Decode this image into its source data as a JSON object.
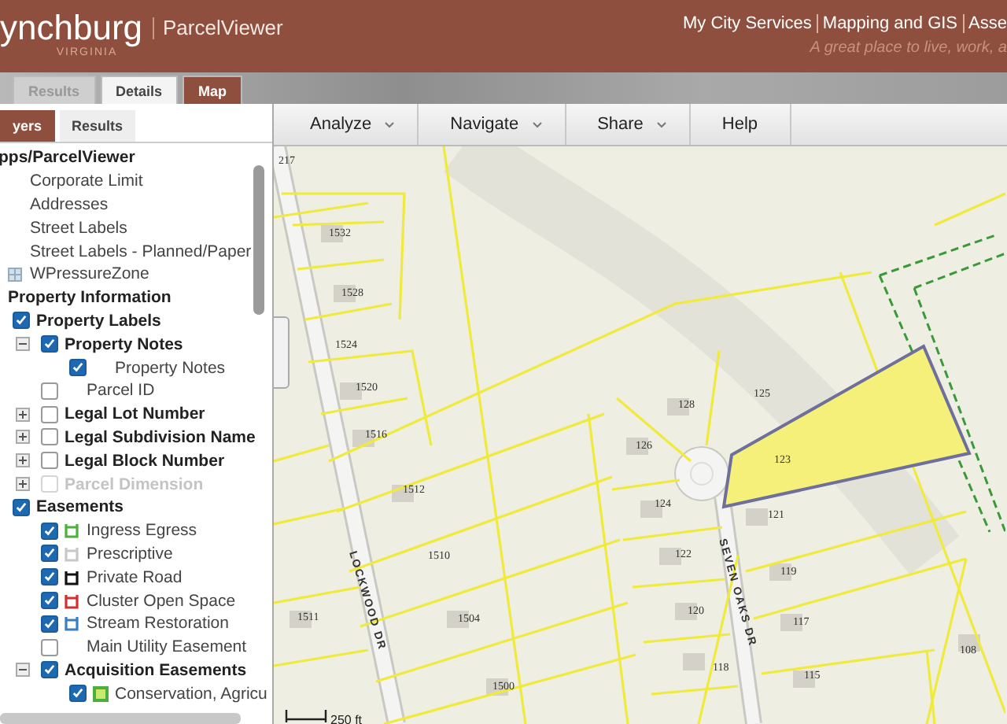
{
  "header": {
    "logo": "ynchburg",
    "logo_sub": "VIRGINIA",
    "app_name": "ParcelViewer",
    "links": [
      "My City Services",
      "Mapping and GIS",
      "Asse"
    ],
    "tagline": "A great place to live, work, a"
  },
  "main_tabs": [
    {
      "label": "Results",
      "selected": false,
      "disabled": true
    },
    {
      "label": "Details",
      "selected": false,
      "disabled": false
    },
    {
      "label": "Map",
      "selected": true,
      "disabled": false
    }
  ],
  "panel_tabs": [
    {
      "label": "yers",
      "selected": true
    },
    {
      "label": "Results",
      "selected": false
    }
  ],
  "layers": {
    "title": "pps/ParcelViewer",
    "items": [
      {
        "kind": "layer",
        "label": "Corporate Limit"
      },
      {
        "kind": "layer",
        "label": "Addresses"
      },
      {
        "kind": "layer",
        "label": "Street Labels"
      },
      {
        "kind": "layer",
        "label": "Street Labels - Planned/Paper"
      },
      {
        "kind": "layer",
        "label": "WPressureZone",
        "swatch": {
          "kind": "grid"
        }
      },
      {
        "kind": "group",
        "label": "Property Information",
        "children": [
          {
            "kind": "group",
            "label": "Property Labels",
            "checked": true,
            "children": [
              {
                "kind": "group",
                "label": "Property Notes",
                "checked": true,
                "expanded": true,
                "children": [
                  {
                    "kind": "layer",
                    "label": "Property Notes",
                    "checked": true
                  }
                ]
              },
              {
                "kind": "layer",
                "label": "Parcel ID",
                "checked": false
              },
              {
                "kind": "group",
                "label": "Legal Lot Number",
                "checked": false,
                "expanded": false
              },
              {
                "kind": "group",
                "label": "Legal Subdivision Name",
                "checked": false,
                "expanded": false
              },
              {
                "kind": "group",
                "label": "Legal Block Number",
                "checked": false,
                "expanded": false
              },
              {
                "kind": "group",
                "label": "Parcel Dimension",
                "checked": false,
                "expanded": false,
                "disabled": true
              }
            ]
          },
          {
            "kind": "group",
            "label": "Easements",
            "checked": true,
            "children": [
              {
                "kind": "layer",
                "label": "Ingress Egress",
                "checked": true,
                "swatch": {
                  "kind": "line"
                },
                "color": "#4caf3c"
              },
              {
                "kind": "layer",
                "label": "Prescriptive",
                "checked": true,
                "swatch": {
                  "kind": "line"
                },
                "color": "#c8c8c8"
              },
              {
                "kind": "layer",
                "label": "Private Road",
                "checked": true,
                "swatch": {
                  "kind": "line"
                },
                "color": "#111111"
              },
              {
                "kind": "layer",
                "label": "Cluster Open Space",
                "checked": true,
                "swatch": {
                  "kind": "line"
                },
                "color": "#d03030"
              },
              {
                "kind": "layer",
                "label": "Stream Restoration",
                "checked": true,
                "swatch": {
                  "kind": "line"
                },
                "color": "#3a7fc0"
              },
              {
                "kind": "layer",
                "label": "Main Utility Easement",
                "checked": false
              },
              {
                "kind": "group",
                "label": "Acquisition Easements",
                "checked": true,
                "expanded": true,
                "children": [
                  {
                    "kind": "layer",
                    "label": "Conservation, Agricu",
                    "checked": true,
                    "swatch": {
                      "kind": "square"
                    },
                    "color": "#4caf3c"
                  }
                ]
              }
            ]
          }
        ]
      }
    ]
  },
  "toolbar": [
    {
      "label": "Analyze",
      "dropdown": true
    },
    {
      "label": "Navigate",
      "dropdown": true
    },
    {
      "label": "Share",
      "dropdown": true
    },
    {
      "label": "Help",
      "dropdown": false
    }
  ],
  "map": {
    "parcel_labels": [
      "217",
      "1532",
      "1528",
      "1524",
      "1520",
      "1516",
      "1512",
      "1510",
      "1511",
      "1504",
      "1500",
      "128",
      "125",
      "126",
      "123",
      "124",
      "121",
      "122",
      "119",
      "120",
      "117",
      "118",
      "115",
      "108"
    ],
    "streets": [
      "LOCKWOOD DR",
      "SEVEN OAKS DR"
    ],
    "scale": "250 ft"
  }
}
